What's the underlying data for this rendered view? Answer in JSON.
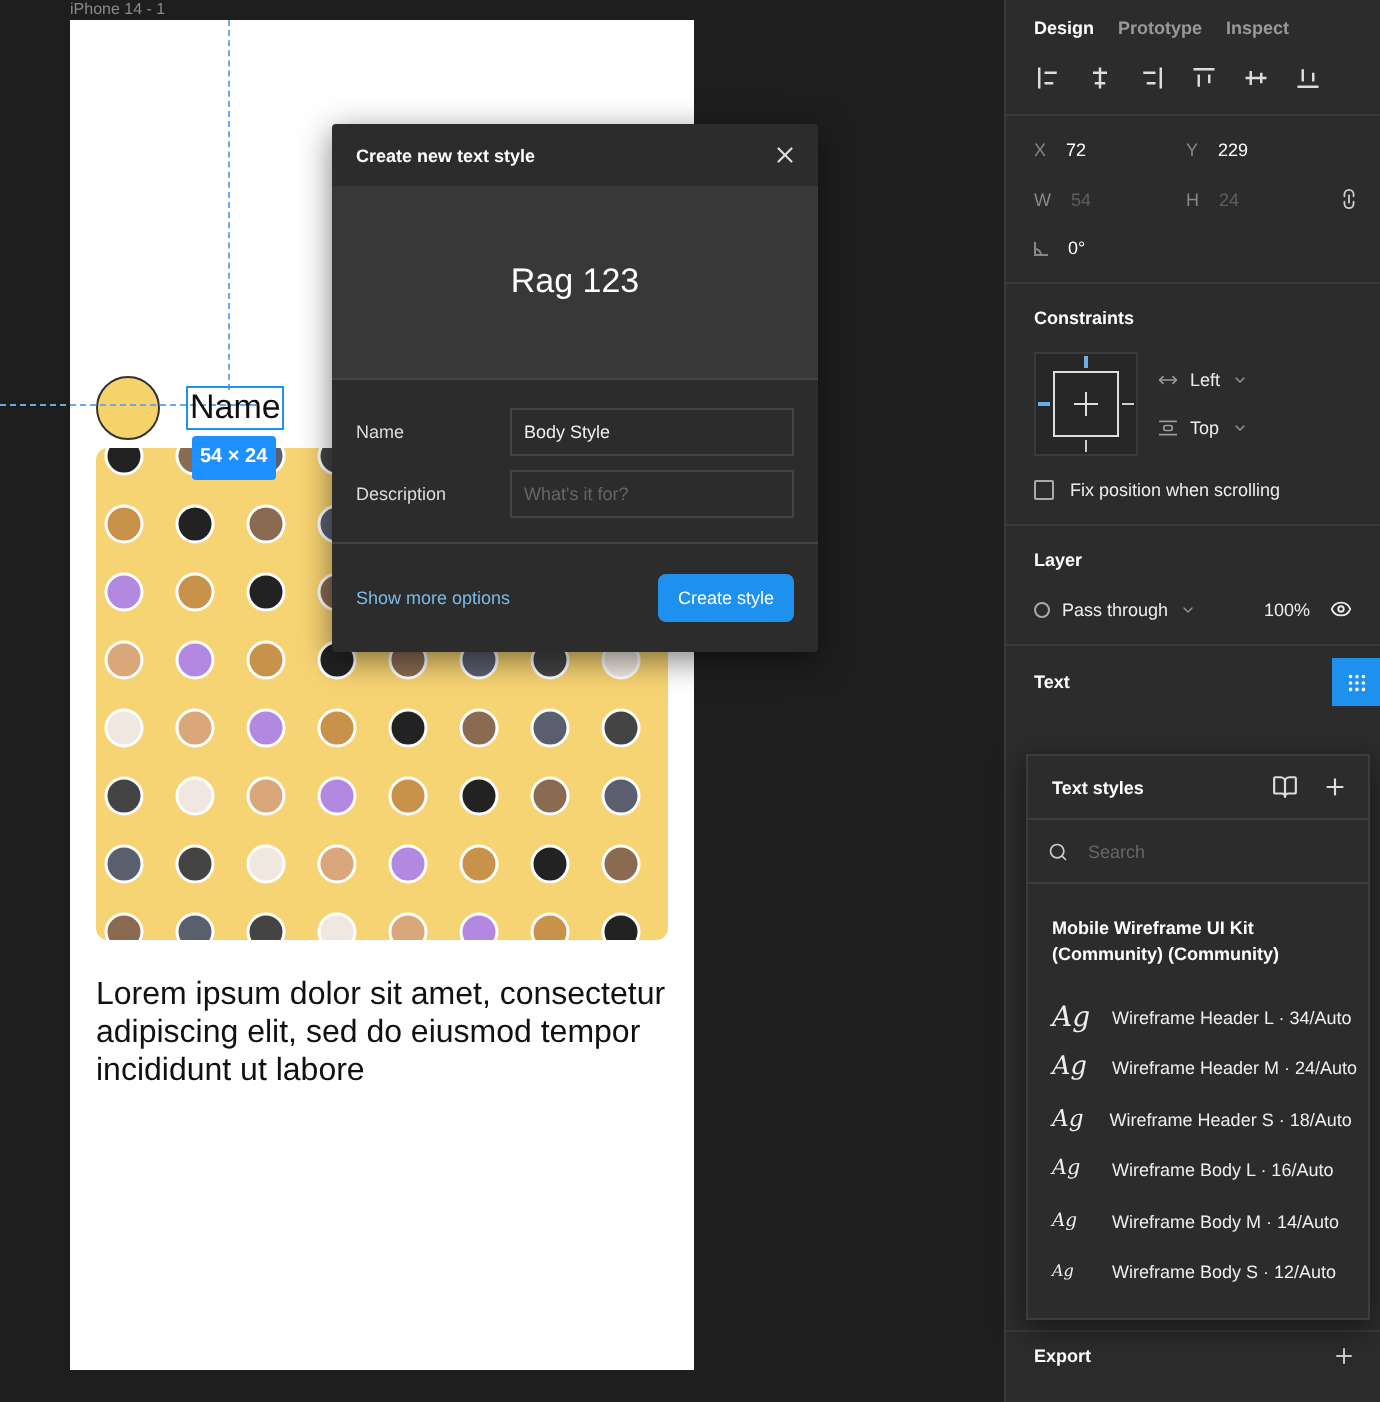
{
  "canvas": {
    "frame_label": "iPhone 14 - 1",
    "name_text": "Name",
    "size_badge": "54 × 24",
    "body_text": "Lorem ipsum dolor sit amet, consectetur adipiscing elit, sed do eiusmod tempor incididunt ut labore"
  },
  "dialog": {
    "title": "Create new text style",
    "preview": "Rag 123",
    "fields": [
      {
        "label": "Name",
        "value": "Body Style"
      },
      {
        "label": "Description",
        "placeholder": "What's it for?"
      }
    ],
    "link": "Show more options",
    "button": "Create style"
  },
  "panel": {
    "tabs": [
      {
        "label": "Design",
        "selected": true
      },
      {
        "label": "Prototype",
        "selected": false
      },
      {
        "label": "Inspect",
        "selected": false
      }
    ],
    "geometry": [
      {
        "label": "X",
        "value": "72",
        "disabled": false
      },
      {
        "label": "Y",
        "value": "229",
        "disabled": false
      },
      {
        "label": "W",
        "value": "54",
        "disabled": true
      },
      {
        "label": "H",
        "value": "24",
        "disabled": true
      }
    ],
    "rotation": "0°",
    "constraints": {
      "title": "Constraints",
      "horizontal": "Left",
      "vertical": "Top",
      "fix_label": "Fix position when scrolling",
      "fix_checked": false
    },
    "layer": {
      "title": "Layer",
      "blend": "Pass through",
      "opacity": "100%"
    },
    "text_title": "Text",
    "export_title": "Export"
  },
  "text_styles": {
    "title": "Text styles",
    "search_placeholder": "Search",
    "library": "Mobile Wireframe UI Kit (Community) (Community)",
    "items": [
      {
        "sample": "Ag",
        "name": "Wireframe Header L · 34/Auto"
      },
      {
        "sample": "Ag",
        "name": "Wireframe Header M · 24/Auto"
      },
      {
        "sample": "Ag",
        "name": "Wireframe Header S · 18/Auto"
      },
      {
        "sample": "Ag",
        "name": "Wireframe Body L · 16/Auto"
      },
      {
        "sample": "Ag",
        "name": "Wireframe Body M · 14/Auto"
      },
      {
        "sample": "Ag",
        "name": "Wireframe Body S · 12/Auto"
      }
    ]
  }
}
